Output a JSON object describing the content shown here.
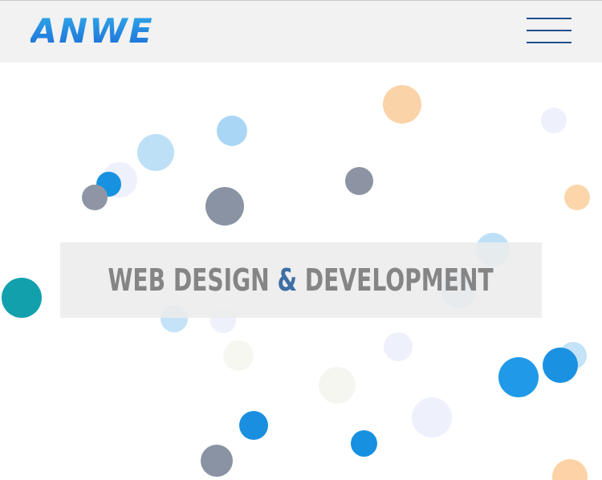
{
  "header": {
    "logo_text": "ANWE",
    "menu_icon": "hamburger-menu-icon",
    "accent_color": "#1e4f8c"
  },
  "hero": {
    "headline_part1": "WEB DESIGN ",
    "headline_amp": "&",
    "headline_part2": " DEVELOPMENT",
    "headline_color": "#858585",
    "amp_color": "#3e6ea5"
  }
}
